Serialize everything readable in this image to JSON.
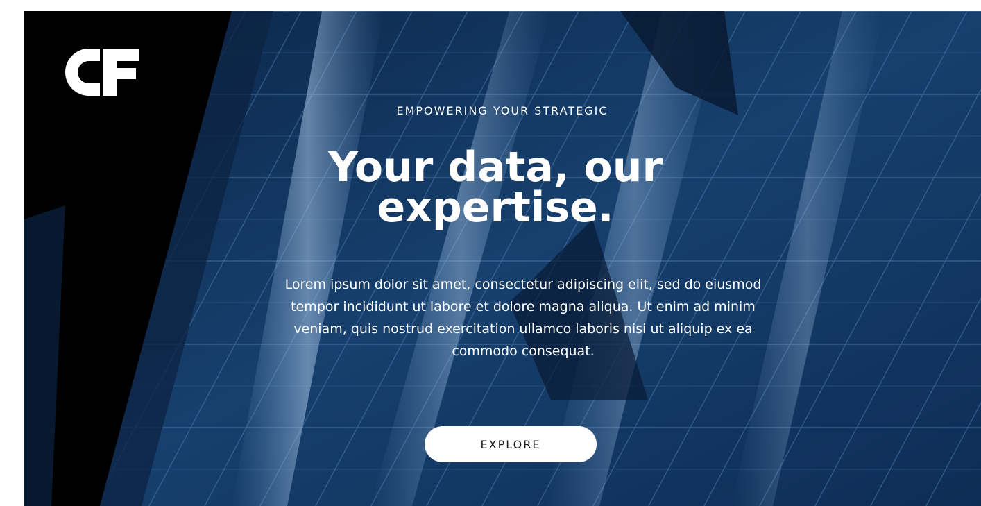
{
  "logo": {
    "text": "C&F",
    "icon": "brand-logo-mark"
  },
  "hero": {
    "eyebrow": "EMPOWERING YOUR STRATEGIC",
    "headline_line1": "Your data, our",
    "headline_line2": "expertise.",
    "body": "Lorem ipsum dolor sit amet, consectetur adipiscing elit, sed do eiusmod tempor incididunt ut labore et dolore magna aliqua. Ut enim ad minim veniam, quis nostrud exercitation ullamco laboris nisi ut aliquip ex ea commodo consequat.",
    "cta_label": "EXPLORE"
  },
  "colors": {
    "background_blue": "#0b2a4f",
    "text": "#ffffff",
    "button_bg": "#ffffff",
    "button_text": "#1a1a1a"
  }
}
